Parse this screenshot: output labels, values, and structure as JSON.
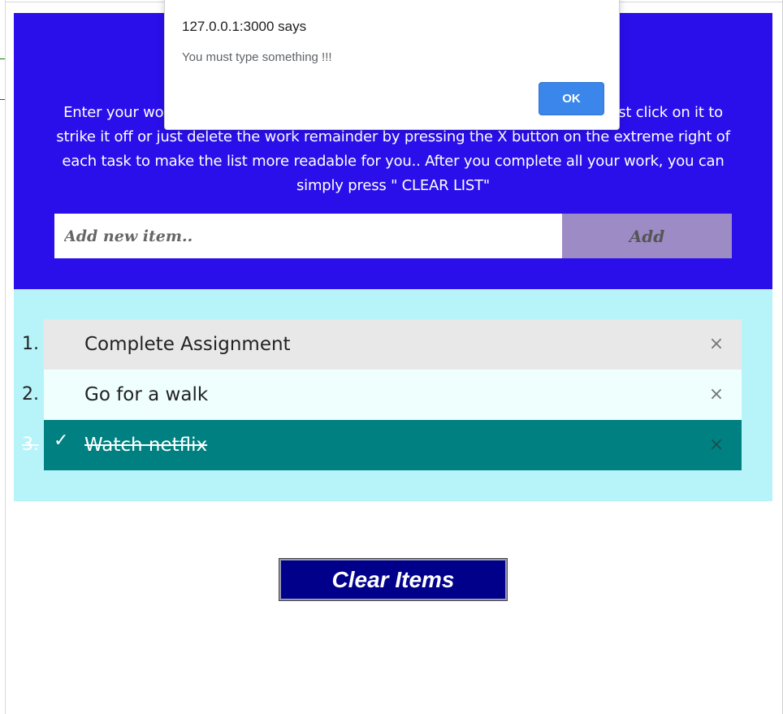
{
  "alert": {
    "title": "127.0.0.1:3000 says",
    "message": "You must type something !!!",
    "ok_label": "OK"
  },
  "header": {
    "instructions": "Enter your work reminders in the box below. Once you complete your work just click on it to strike it off or just delete the work remainder by pressing the X button on the extreme right of each task to make the list more readable for you.. After you complete all your work, you can simply press \" CLEAR LIST\""
  },
  "input": {
    "placeholder": "Add new item..",
    "add_label": "Add"
  },
  "tasks": [
    {
      "number": "1.",
      "text": "Complete Assignment",
      "done": false,
      "close": "×"
    },
    {
      "number": "2.",
      "text": "Go for a walk",
      "done": false,
      "close": "×"
    },
    {
      "number": "3.",
      "text": "Watch netflix",
      "done": true,
      "check": "✓",
      "close": "×"
    }
  ],
  "clear_button": {
    "label": "Clear Items"
  },
  "colors": {
    "header_bg": "#2a0fea",
    "list_bg": "#b7f4fa",
    "done_row": "#008080",
    "clear_bg": "#00008b",
    "ok_bg": "#3a86ea"
  }
}
